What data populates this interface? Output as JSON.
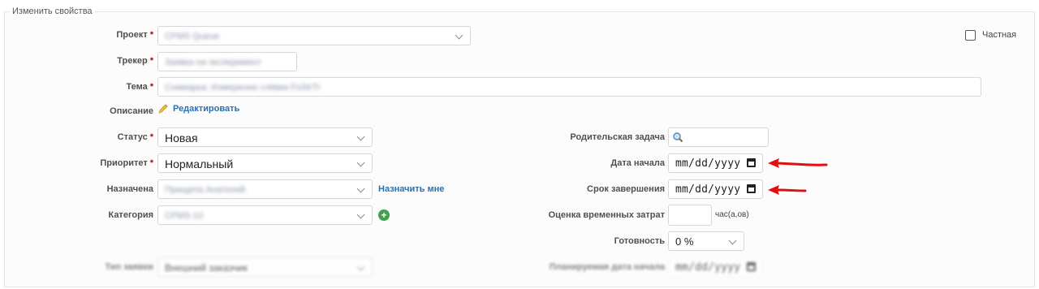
{
  "fieldset": {
    "legend": "Изменить свойства"
  },
  "private": {
    "label": "Частная"
  },
  "project": {
    "label": "Проект",
    "value": "CFMS Queue"
  },
  "tracker": {
    "label": "Трекер",
    "value": "Заявка на эксперимент"
  },
  "subject": {
    "label": "Тема",
    "value": "Снимарка: Измерение слёвки FsStrTr"
  },
  "description": {
    "label": "Описание",
    "edit_label": "Редактировать"
  },
  "status": {
    "label": "Статус",
    "value": "Новая"
  },
  "priority": {
    "label": "Приоритет",
    "value": "Нормальный"
  },
  "assignee": {
    "label": "Назначена",
    "value": "Прищепа Анатолий",
    "assign_me": "Назначить мне"
  },
  "category": {
    "label": "Категория",
    "value": "CFMS-10"
  },
  "parent": {
    "label": "Родительская задача"
  },
  "start_date": {
    "label": "Дата начала",
    "placeholder": "mm/dd/yyyy"
  },
  "due_date": {
    "label": "Срок завершения",
    "placeholder": "mm/dd/yyyy"
  },
  "estimate": {
    "label": "Оценка временных затрат",
    "unit": "час(а,ов)"
  },
  "done_ratio": {
    "label": "Готовность",
    "value": "0 %"
  },
  "blurred": {
    "left_label": "Тип заявки",
    "left_value": "Внешний заказчик",
    "right_label": "Планируемая дата начала",
    "right_value": "mm/dd/yyyy"
  },
  "colors": {
    "required": "#bb0000",
    "link": "#2a6fb0",
    "arrow": "#e01010"
  }
}
